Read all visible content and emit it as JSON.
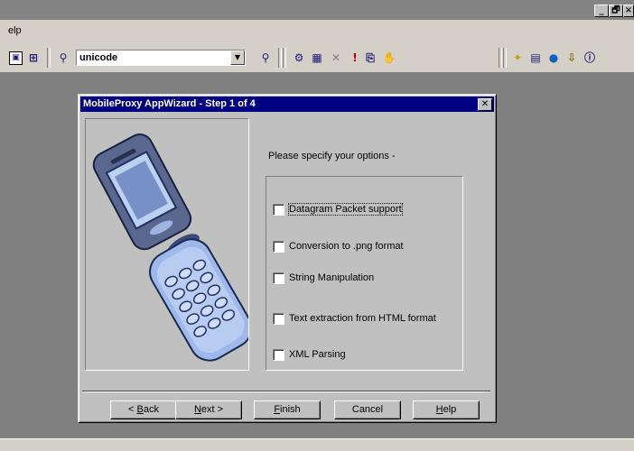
{
  "window": {
    "min_label": "_",
    "max_label": "🗗",
    "close_label": "×"
  },
  "menu": {
    "help_first": "H",
    "help_rest": "elp"
  },
  "toolbar": {
    "combo_value": "unicode",
    "combo_arrow": "▼"
  },
  "dialog": {
    "title": "MobileProxy AppWizard - Step 1 of 4",
    "close_label": "✕",
    "prompt": "Please specify your options -",
    "options": [
      {
        "label": "Datagram Packet support",
        "checked": false
      },
      {
        "label": "Conversion to .png format",
        "checked": false
      },
      {
        "label": "String Manipulation",
        "checked": false
      },
      {
        "label": "Text extraction from HTML format",
        "checked": false
      },
      {
        "label": "XML Parsing",
        "checked": false
      }
    ],
    "buttons": {
      "back_pre": "< ",
      "back_ul": "B",
      "back_post": "ack",
      "next_ul": "N",
      "next_post": "ext >",
      "finish_ul": "F",
      "finish_post": "inish",
      "cancel": "Cancel",
      "help_ul": "H",
      "help_post": "elp"
    }
  }
}
